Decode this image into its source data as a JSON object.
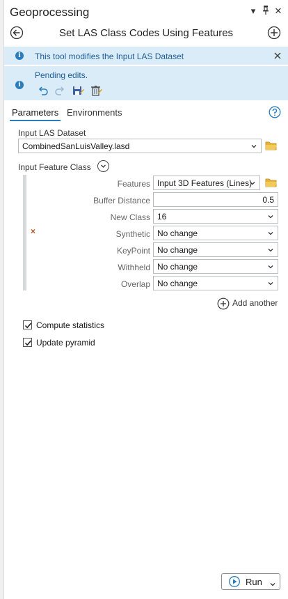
{
  "pane": {
    "title": "Geoprocessing",
    "tool_name": "Set LAS Class Codes Using Features"
  },
  "titlebar": {
    "menu_glyph": "▾",
    "pin_glyph": "📌",
    "close_glyph": "✕"
  },
  "messages": {
    "modifies": "This tool modifies the Input LAS Dataset",
    "pending": "Pending edits.",
    "info_glyph": "i"
  },
  "tabs": [
    {
      "label": "Parameters"
    },
    {
      "label": "Environments"
    }
  ],
  "params": {
    "input_las_label": "Input LAS Dataset",
    "input_las_value": "CombinedSanLuisValley.lasd",
    "input_feature_class_label": "Input Feature Class",
    "rows": [
      {
        "label": "Features",
        "value": "Input 3D Features (Lines)"
      },
      {
        "label": "Buffer Distance",
        "value": "0.5"
      },
      {
        "label": "New Class",
        "value": "16"
      },
      {
        "label": "Synthetic",
        "value": "No change"
      },
      {
        "label": "KeyPoint",
        "value": "No change"
      },
      {
        "label": "Withheld",
        "value": "No change"
      },
      {
        "label": "Overlap",
        "value": "No change"
      }
    ],
    "add_another_label": "Add another",
    "error_glyph": "×"
  },
  "checks": [
    {
      "label": "Compute statistics",
      "checked": true
    },
    {
      "label": "Update pyramid",
      "checked": true
    }
  ],
  "run": {
    "label": "Run"
  },
  "colors": {
    "accent": "#2a7dbd",
    "banner": "#d9ecf8",
    "folder": "#d9a21b",
    "error": "#c0501f"
  }
}
